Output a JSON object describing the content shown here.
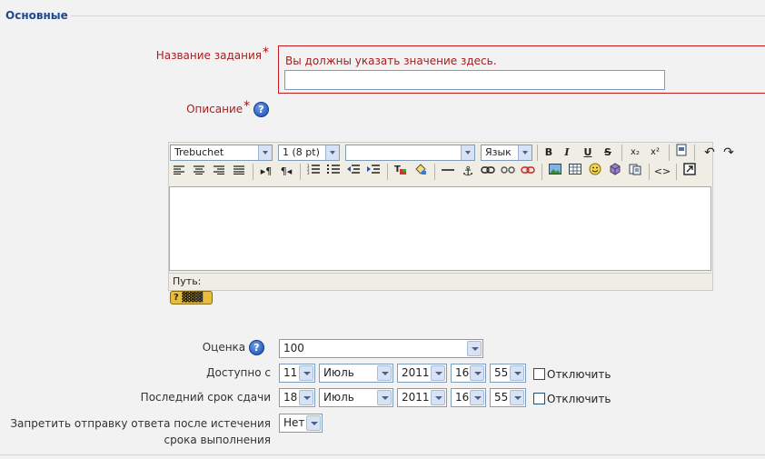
{
  "section": {
    "legend": "Основные"
  },
  "name_field": {
    "label": "Название задания",
    "required_mark": "*",
    "error": "Вы должны указать значение здесь.",
    "value": ""
  },
  "description": {
    "label": "Описание",
    "required_mark": "*",
    "help_glyph": "?",
    "toolbar": {
      "font": "Trebuchet",
      "size": "1 (8 pt)",
      "heading": "",
      "language": "Язык",
      "bold": "B",
      "italic": "I",
      "underline": "U",
      "strike": "S",
      "subscript": "x₂",
      "superscript": "x²",
      "html_toggle": "<>"
    },
    "path_label": "Путь:",
    "help_kbd_label": "?"
  },
  "grade": {
    "label": "Оценка",
    "value": "100",
    "help_glyph": "?"
  },
  "available_from": {
    "label": "Доступно с",
    "day": "11",
    "month": "Июль",
    "year": "2011",
    "hour": "16",
    "minute": "55",
    "disable_label": "Отключить"
  },
  "due_date": {
    "label": "Последний срок сдачи",
    "day": "18",
    "month": "Июль",
    "year": "2011",
    "hour": "16",
    "minute": "55",
    "disable_label": "Отключить"
  },
  "prevent_late": {
    "label_line1": "Запретить отправку ответа после истечения",
    "label_line2": "срока выполнения",
    "value": "Нет"
  },
  "colors": {
    "legend": "#1e4a8c",
    "error": "#a42020",
    "required": "#cc0000"
  }
}
